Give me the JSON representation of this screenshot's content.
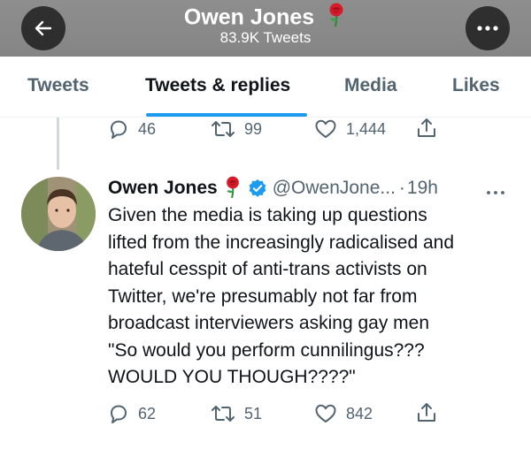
{
  "header": {
    "title": "Owen Jones",
    "tweet_count": "83.9K Tweets"
  },
  "tabs": [
    {
      "label": "Tweets"
    },
    {
      "label": "Tweets & replies"
    },
    {
      "label": "Media"
    },
    {
      "label": "Likes"
    }
  ],
  "prev_tweet": {
    "replies": "46",
    "retweets": "99",
    "likes": "1,444"
  },
  "tweet": {
    "author": "Owen Jones",
    "handle": "@OwenJone...",
    "dot": "·",
    "time": "19h",
    "lines": [
      "Given the media is taking up questions",
      "lifted from the increasingly radicalised and",
      "hateful cesspit of anti-trans activists on",
      "Twitter, we're presumably not far from",
      "broadcast interviewers asking gay men",
      "\"So would you perform cunnilingus???",
      "WOULD YOU THOUGH????\""
    ],
    "replies": "62",
    "retweets": "51",
    "likes": "842"
  },
  "colors": {
    "accent": "#1d9bf0",
    "muted": "#536471",
    "rose": "#d81b2a"
  }
}
